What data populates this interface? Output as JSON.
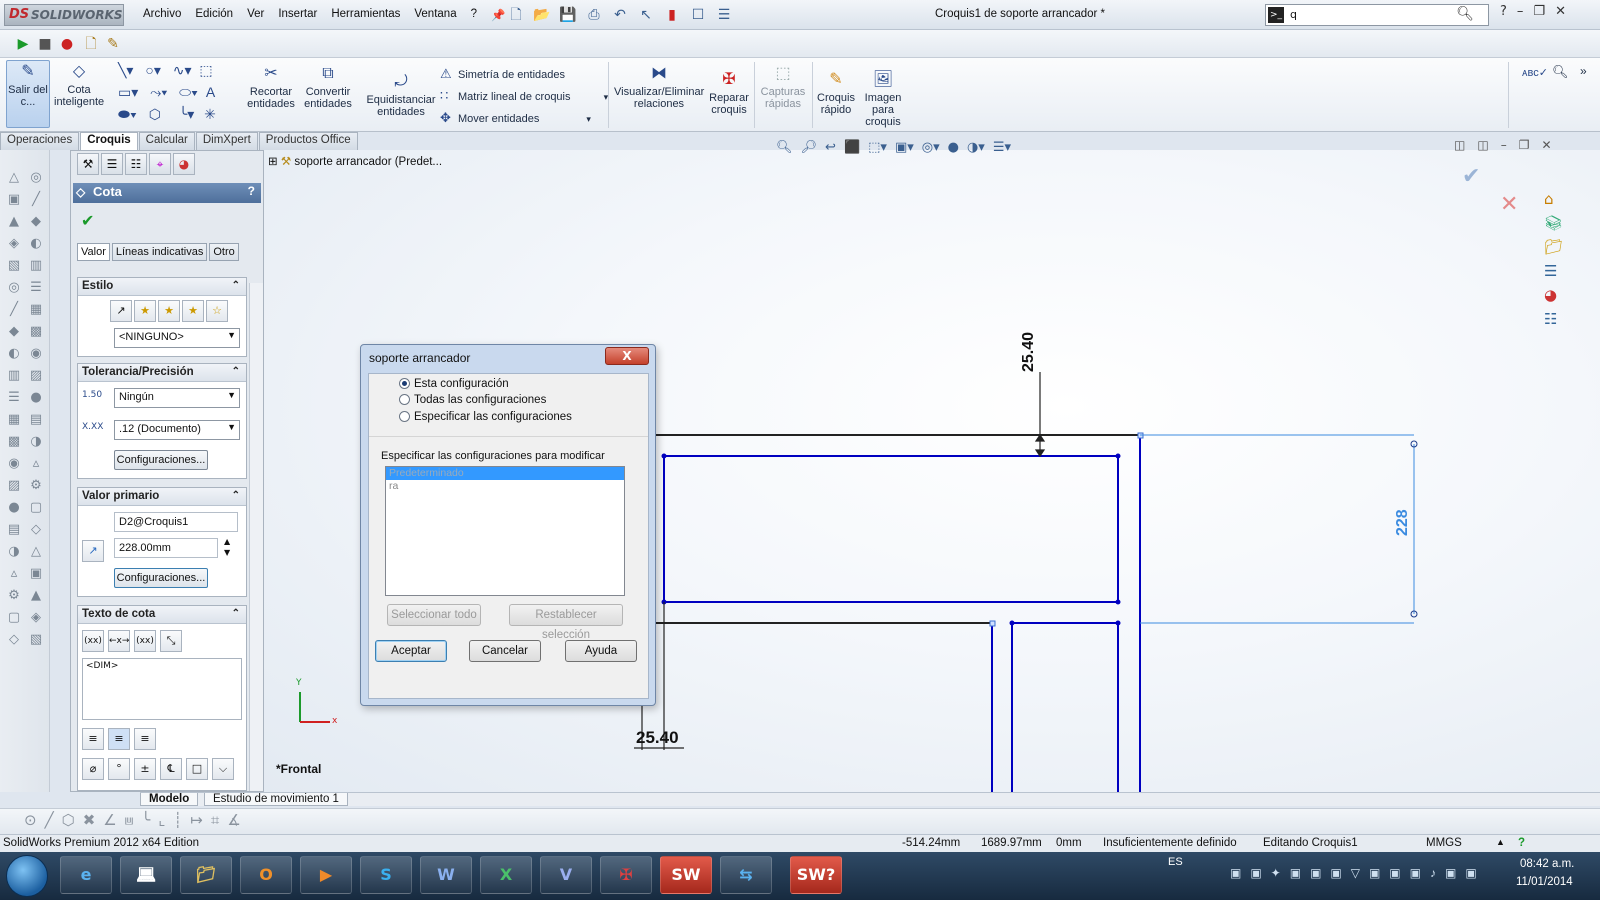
{
  "app": {
    "logo": "SOLIDWORKS",
    "document_title": "Croquis1 de soporte arrancador *"
  },
  "menu": [
    "Archivo",
    "Edición",
    "Ver",
    "Insertar",
    "Herramientas",
    "Ventana",
    "?"
  ],
  "search": {
    "value": "q"
  },
  "command_manager": {
    "exit_sketch": "Salir del c...",
    "smart_dim": "Cota inteligente",
    "trim": "Recortar entidades",
    "convert": "Convertir entidades",
    "offset": "Equidistanciar entidades",
    "mirror": "Simetría de entidades",
    "linear_pattern": "Matriz lineal de croquis",
    "move": "Mover entidades",
    "relations": "Visualizar/Eliminar relaciones",
    "repair": "Reparar croquis",
    "quick_snaps": "Capturas rápidas",
    "rapid_sketch": "Croquis rápido",
    "sketch_picture": "Imagen para croquis"
  },
  "cm_tabs": [
    "Operaciones",
    "Croquis",
    "Calcular",
    "DimXpert",
    "Productos Office"
  ],
  "cm_active_tab": "Croquis",
  "property_manager": {
    "title": "Cota",
    "help": "?",
    "tabs": [
      "Valor",
      "Líneas indicativas",
      "Otro"
    ],
    "style": {
      "header": "Estilo",
      "select": "<NINGUNO>"
    },
    "tolerance": {
      "header": "Tolerancia/Precisión",
      "type": "Ningún",
      "precision": ".12 (Documento)",
      "config_btn": "Configuraciones...",
      "tol_icon": "1.50",
      "prec_icon": "X.XX"
    },
    "primary": {
      "header": "Valor primario",
      "name": "D2@Croquis1",
      "value": "228.00mm",
      "config_btn": "Configuraciones..."
    },
    "dim_text": {
      "header": "Texto de cota",
      "content": "<DIM>",
      "btns": [
        "(xx)",
        "←x→",
        "(xx)"
      ]
    }
  },
  "tree": {
    "root": "soporte arrancador  (Predet..."
  },
  "view_label": "*Frontal",
  "dims": {
    "top": "25.40",
    "right": "228",
    "bottom": "25.40"
  },
  "axes": {
    "x": "x",
    "y": "Y"
  },
  "dialog": {
    "title": "soporte arrancador",
    "close": "X",
    "options": [
      "Esta configuración",
      "Todas las configuraciones",
      "Especificar las configuraciones"
    ],
    "selected_option": 0,
    "list_label": "Especificar las configuraciones para modificar",
    "list_items": [
      "Predeterminado",
      "ra"
    ],
    "select_all": "Seleccionar todo",
    "reset_selection": "Restablecer selección",
    "ok": "Aceptar",
    "cancel": "Cancelar",
    "help": "Ayuda"
  },
  "bottom_tabs": [
    "Modelo",
    "Estudio de movimiento 1"
  ],
  "status": {
    "edition": "SolidWorks Premium 2012 x64 Edition",
    "x": "-514.24mm",
    "y": "1689.97mm",
    "z": "0mm",
    "state": "Insuficientemente definido",
    "editing": "Editando Croquis1",
    "units": "MMGS"
  },
  "taskbar": {
    "lang": "ES",
    "time": "08:42 a.m.",
    "date": "11/01/2014"
  },
  "colors": {
    "sketch_blue": "#0000c0",
    "dim_blue": "#3b8be0",
    "titlebar": "#dbe3ec",
    "taskbar": "#1e3550"
  }
}
